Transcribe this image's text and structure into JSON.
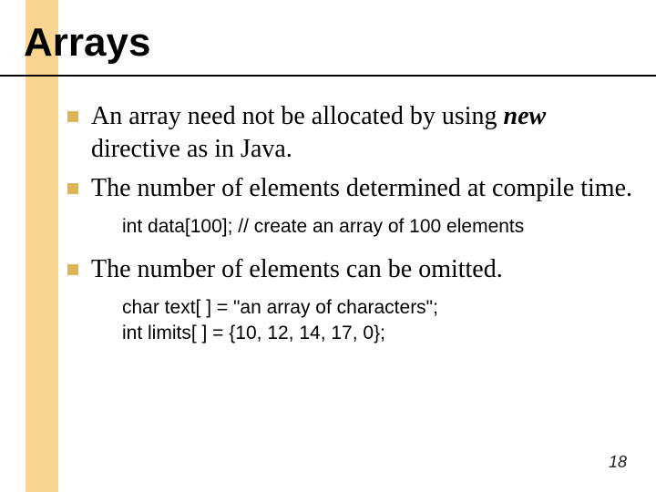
{
  "title": "Arrays",
  "bullets": [
    {
      "pre": "An array need not be allocated by using ",
      "kw": "new",
      "post": " directive as in Java."
    },
    {
      "pre": "The number of elements determined at compile time.",
      "kw": "",
      "post": ""
    },
    {
      "pre": "The number of elements can be omitted.",
      "kw": "",
      "post": ""
    }
  ],
  "code1": {
    "line1": "int data[100]; // create an array of 100 elements"
  },
  "code2": {
    "line1": "char text[ ] = \"an array of characters\";",
    "line2": "int limits[ ] = {10, 12, 14, 17, 0};"
  },
  "page_number": "18"
}
